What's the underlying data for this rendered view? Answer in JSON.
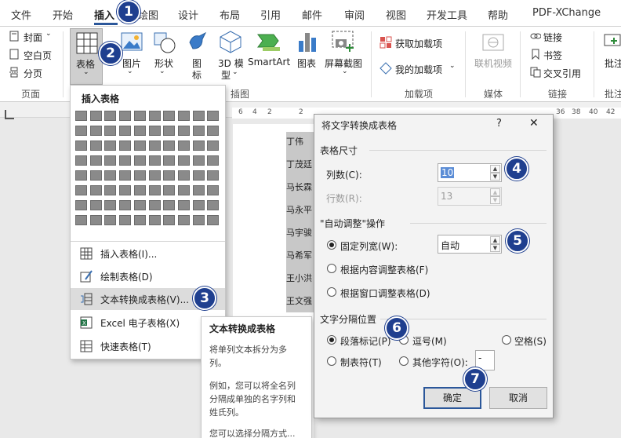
{
  "tabs": [
    "文件",
    "开始",
    "插入",
    "绘图",
    "设计",
    "布局",
    "引用",
    "邮件",
    "审阅",
    "视图",
    "开发工具",
    "帮助",
    "PDF-XChange"
  ],
  "ribbon": {
    "pages": {
      "cover": "封面",
      "blank": "空白页",
      "break": "分页",
      "group": "页面"
    },
    "tables": {
      "table": "表格"
    },
    "illustrations": {
      "pictures": "图片",
      "shapes": "形状",
      "icons1": "图",
      "icons2": "标",
      "model1": "3D 模",
      "model2": "型",
      "smartart": "SmartArt",
      "chart": "图表",
      "screenshot": "屏幕截图",
      "group": "插图"
    },
    "addins": {
      "get": "获取加载项",
      "my": "我的加载项",
      "group": "加载项"
    },
    "media": {
      "video": "联机视频",
      "group": "媒体"
    },
    "links": {
      "link": "链接",
      "bookmark": "书签",
      "xref": "交叉引用",
      "group": "链接"
    },
    "comments": {
      "comment": "批注",
      "group": "批注"
    }
  },
  "ruler": [
    "6",
    "4",
    "2",
    "2",
    "36",
    "38",
    "40",
    "42"
  ],
  "dropdown": {
    "header": "插入表格",
    "items": [
      "插入表格(I)...",
      "绘制表格(D)",
      "文本转换成表格(V)...",
      "Excel 电子表格(X)",
      "快速表格(T)"
    ]
  },
  "tooltip": {
    "title": "文本转换成表格",
    "p1": "将单列文本拆分为多列。",
    "p2": "例如，您可以将全名列分隔成单独的名字列和姓氏列。",
    "p3": "您可以选择分隔方式..."
  },
  "document": {
    "lines": [
      "丁伟",
      "丁茂廷",
      "马长霖",
      "马永平",
      "马宇骏",
      "马希军",
      "王小洪",
      "王文强"
    ]
  },
  "dialog": {
    "title": "将文字转换成表格",
    "help": "?",
    "close": "✕",
    "size_section": "表格尺寸",
    "cols_label": "列数(C):",
    "cols_value": "10",
    "rows_label": "行数(R):",
    "rows_value": "13",
    "autofit_section": "\"自动调整\"操作",
    "fixed": "固定列宽(W):",
    "fixed_value": "自动",
    "content": "根据内容调整表格(F)",
    "window": "根据窗口调整表格(D)",
    "sep_section": "文字分隔位置",
    "para": "段落标记(P)",
    "comma": "逗号(M)",
    "space": "空格(S)",
    "tab": "制表符(T)",
    "other": "其他字符(O):",
    "other_value": "-",
    "ok": "确定",
    "cancel": "取消"
  },
  "badges": [
    "1",
    "2",
    "3",
    "4",
    "5",
    "6",
    "7"
  ],
  "colors": {
    "accent": "#2b579a",
    "badge": "#1f3f8f",
    "highlight": "#dcdcdc",
    "grid_cell": "#8a8a8a"
  }
}
